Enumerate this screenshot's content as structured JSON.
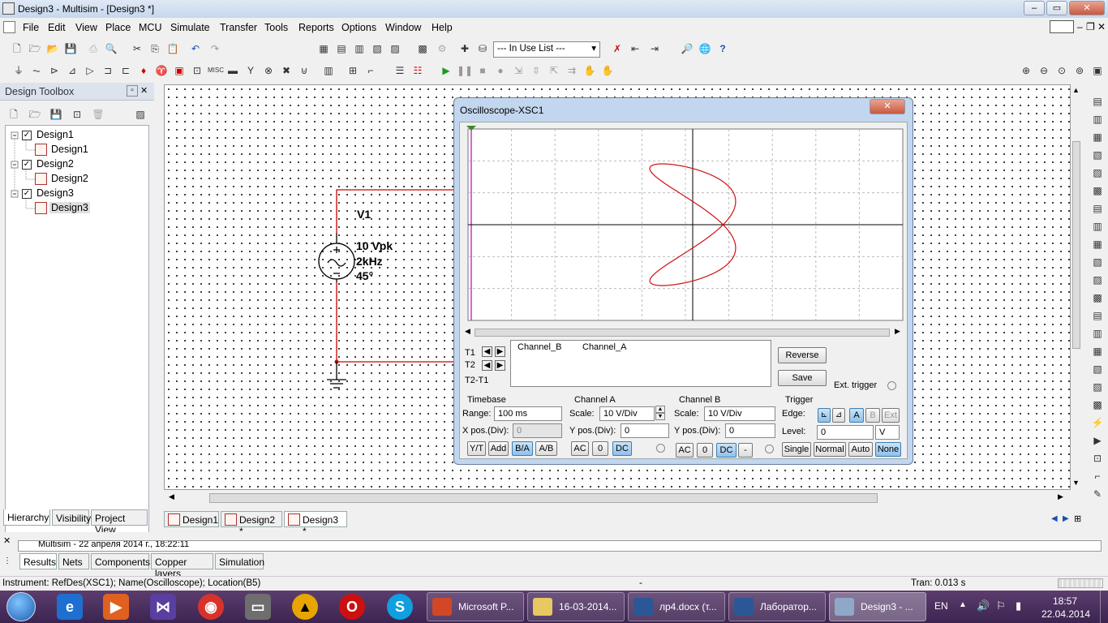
{
  "window": {
    "title": "Design3 - Multisim - [Design3 *]"
  },
  "menu": [
    "File",
    "Edit",
    "View",
    "Place",
    "MCU",
    "Simulate",
    "Transfer",
    "Tools",
    "Reports",
    "Options",
    "Window",
    "Help"
  ],
  "toolbar": {
    "in_use_list": "--- In Use List ---"
  },
  "toolbox": {
    "title": "Design Toolbox",
    "tree": [
      {
        "label": "Design1",
        "child": "Design1"
      },
      {
        "label": "Design2",
        "child": "Design2"
      },
      {
        "label": "Design3",
        "child": "Design3"
      }
    ],
    "tabs": [
      "Hierarchy",
      "Visibility",
      "Project View"
    ]
  },
  "schematic": {
    "source_ref": "V1",
    "source_amp": "10 Vpk",
    "source_freq": "2kHz",
    "source_phase": "45°",
    "tabs": [
      "Design1",
      "Design2 *",
      "Design3 *"
    ]
  },
  "oscilloscope": {
    "title": "Oscilloscope-XSC1",
    "t1": "T1",
    "t2": "T2",
    "t2t1": "T2-T1",
    "col_b": "Channel_B",
    "col_a": "Channel_A",
    "reverse": "Reverse",
    "save": "Save",
    "ext_trigger": "Ext. trigger",
    "timebase": {
      "title": "Timebase",
      "range_label": "Range:",
      "range": "100 ms",
      "xpos_label": "X pos.(Div):",
      "xpos": "0",
      "modes": [
        "Y/T",
        "Add",
        "B/A",
        "A/B"
      ]
    },
    "channel_a": {
      "title": "Channel A",
      "scale_label": "Scale:",
      "scale": "10  V/Div",
      "ypos_label": "Y pos.(Div):",
      "ypos": "0",
      "coupling": [
        "AC",
        "0",
        "DC"
      ]
    },
    "channel_b": {
      "title": "Channel B",
      "scale_label": "Scale:",
      "scale": "10  V/Div",
      "ypos_label": "Y pos.(Div):",
      "ypos": "0",
      "coupling": [
        "AC",
        "0",
        "DC",
        "-"
      ]
    },
    "trigger": {
      "title": "Trigger",
      "edge_label": "Edge:",
      "sources": [
        "A",
        "B",
        "Ext"
      ],
      "level_label": "Level:",
      "level": "0",
      "level_unit": "V",
      "modes": [
        "Single",
        "Normal",
        "Auto",
        "None"
      ]
    }
  },
  "results": {
    "log": "Multisim  -  22 апреля 2014 г., 18:22:11",
    "tabs": [
      "Results",
      "Nets",
      "Components",
      "Copper layers",
      "Simulation"
    ]
  },
  "status": {
    "left": "Instrument: RefDes(XSC1); Name(Oscilloscope); Location(B5)",
    "middle": "-",
    "right": "Tran: 0.013 s"
  },
  "taskbar": {
    "items": [
      "Microsoft P...",
      "16-03-2014...",
      "лр4.docx (т...",
      "Лаборатор...",
      "Design3 - ..."
    ],
    "lang": "EN",
    "time": "18:57",
    "date": "22.04.2014"
  },
  "colors": {
    "trace": "#d01010",
    "wire": "#cc0000",
    "accent": "#3c7fb1"
  }
}
